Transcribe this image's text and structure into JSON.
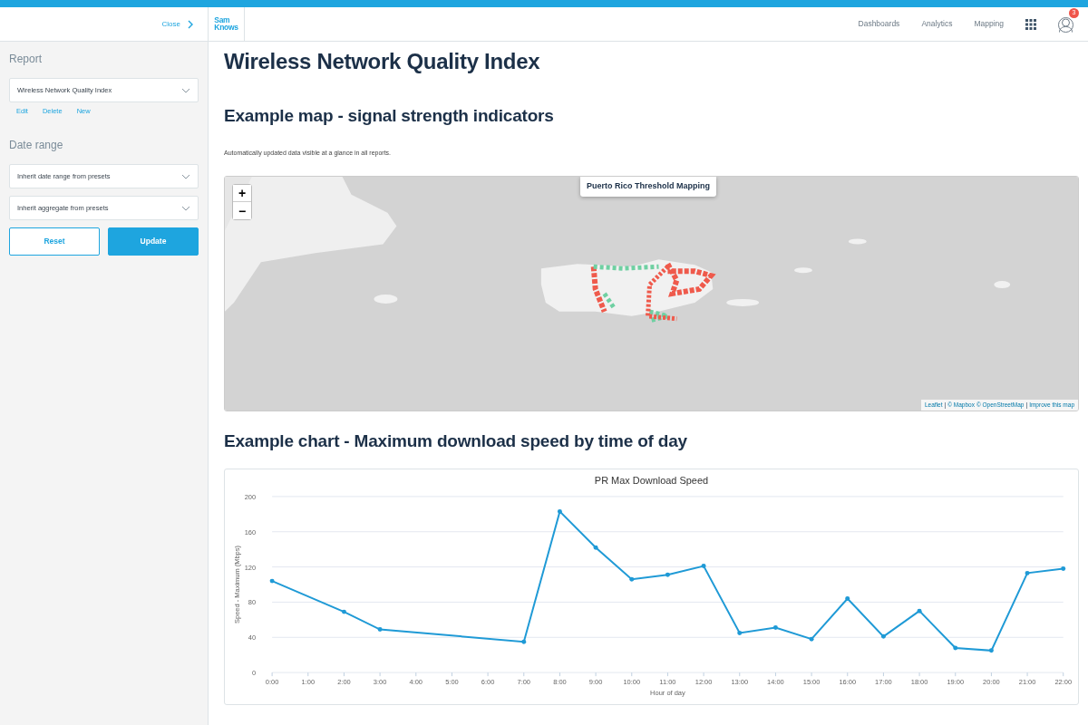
{
  "header": {
    "close_label": "Close",
    "logo": [
      "Sam",
      "Knows"
    ],
    "nav": [
      "Dashboards",
      "Analytics",
      "Mapping"
    ],
    "notification_count": "3"
  },
  "sidebar": {
    "report_heading": "Report",
    "report_select": "Wireless Network Quality Index",
    "report_links": [
      "Edit",
      "Delete",
      "New"
    ],
    "date_heading": "Date range",
    "date_selects": [
      "Inherit date range from presets",
      "Inherit aggregate from presets"
    ],
    "buttons": [
      {
        "label": "Reset",
        "kind": "outline"
      },
      {
        "label": "Update",
        "kind": "primary"
      }
    ]
  },
  "page_title": "Wireless Network Quality Index",
  "map_section": {
    "heading": "Example map - signal strength indicators",
    "description": "Automatically updated data visible at a glance in all reports.",
    "map": {
      "kind": "picture",
      "title": "Puerto Rico Threshold Mapping",
      "zoom_in": "+",
      "zoom_out": "−",
      "attribution": [
        {
          "text": "Leaflet",
          "kind": "link"
        },
        {
          "text": "|",
          "kind": "separator"
        },
        {
          "text": "© Mapbox",
          "kind": "link"
        },
        {
          "text": "© OpenStreetMap",
          "kind": "link"
        },
        {
          "text": "|",
          "kind": "separator"
        },
        {
          "text": "Improve this map",
          "kind": "link"
        }
      ]
    }
  },
  "chart_section": {
    "heading": "Example chart - Maximum download speed by time of day",
    "chart_data": {
      "type": "line",
      "title": "PR Max Download Speed",
      "xlabel": "Hour of day",
      "ylabel": "Speed - Maximum (Mbps)",
      "x": [
        0,
        2,
        3,
        7,
        8,
        9,
        10,
        11,
        12,
        13,
        14,
        15,
        16,
        17,
        18,
        19,
        20,
        21,
        22
      ],
      "grid": true,
      "series": [
        {
          "color": "#1f9ad6",
          "values": [
            104,
            69,
            49,
            35,
            183,
            142,
            106,
            111,
            121,
            45,
            51,
            38,
            84,
            41,
            70,
            28,
            25,
            113,
            118
          ]
        }
      ],
      "xlim": [
        0,
        22
      ],
      "ylim": [
        0,
        200
      ],
      "xticks": [
        {
          "value": 0,
          "label": "0:00"
        },
        {
          "value": 1,
          "label": "1:00"
        },
        {
          "value": 2,
          "label": "2:00"
        },
        {
          "value": 3,
          "label": "3:00"
        },
        {
          "value": 4,
          "label": "4:00"
        },
        {
          "value": 5,
          "label": "5:00"
        },
        {
          "value": 6,
          "label": "6:00"
        },
        {
          "value": 7,
          "label": "7:00"
        },
        {
          "value": 8,
          "label": "8:00"
        },
        {
          "value": 9,
          "label": "9:00"
        },
        {
          "value": 10,
          "label": "10:00"
        },
        {
          "value": 11,
          "label": "11:00"
        },
        {
          "value": 12,
          "label": "12:00"
        },
        {
          "value": 13,
          "label": "13:00"
        },
        {
          "value": 14,
          "label": "14:00"
        },
        {
          "value": 15,
          "label": "15:00"
        },
        {
          "value": 16,
          "label": "16:00"
        },
        {
          "value": 17,
          "label": "17:00"
        },
        {
          "value": 18,
          "label": "18:00"
        },
        {
          "value": 19,
          "label": "19:00"
        },
        {
          "value": 20,
          "label": "20:00"
        },
        {
          "value": 21,
          "label": "21:00"
        },
        {
          "value": 22,
          "label": "22:00"
        }
      ],
      "yticks": [
        0,
        40,
        80,
        120,
        160,
        200
      ]
    }
  }
}
